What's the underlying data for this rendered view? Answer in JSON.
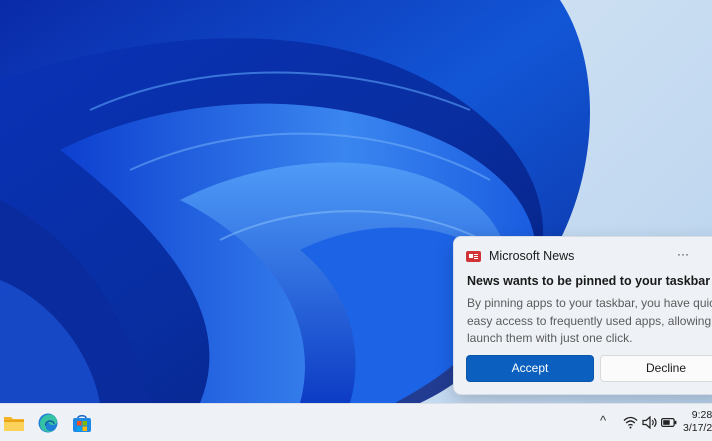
{
  "notification": {
    "app_name": "Microsoft News",
    "more_label": "···",
    "title": "News wants to be pinned to your taskbar",
    "body_lines": [
      "By pinning apps to your taskbar, you have quick an",
      "easy access to frequently used apps, allowing you t",
      "launch them with just one click."
    ],
    "accept_label": "Accept",
    "decline_label": "Decline",
    "accent_color": "#0a5fbf",
    "app_icon": "news-icon"
  },
  "taskbar": {
    "pinned": [
      {
        "name": "file-explorer-icon"
      },
      {
        "name": "edge-icon"
      },
      {
        "name": "store-icon"
      }
    ],
    "tray": {
      "chevron": "^",
      "icons": [
        "wifi-icon",
        "volume-icon",
        "battery-icon"
      ],
      "time": "9:28",
      "date": "3/17/2"
    }
  }
}
